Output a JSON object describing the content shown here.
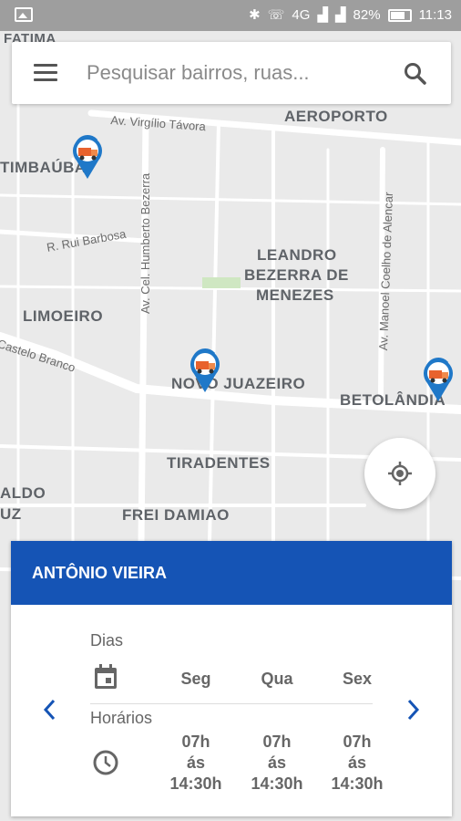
{
  "status_bar": {
    "gallery_icon": "image-icon",
    "icons": [
      "bluetooth-icon",
      "call-icon",
      "signal-4g-icon",
      "signal-icon"
    ],
    "network_label": "4G",
    "battery_percent": "82%",
    "time": "11:13"
  },
  "search": {
    "placeholder": "Pesquisar bairros, ruas...",
    "value": "",
    "menu_icon": "menu-icon",
    "search_icon": "search-icon"
  },
  "map": {
    "neighborhoods": [
      "FATIMA",
      "AEROPORTO",
      "TIMBAÚBA",
      "LEANDRO",
      "BEZERRA DE",
      "MENEZES",
      "LIMOEIRO",
      "NOVO JUAZEIRO",
      "BETOLÂNDIA",
      "TIRADENTES",
      "ALDO",
      "UZ",
      "FREI DAMIAO"
    ],
    "streets": [
      "Av. Virgílio Távora",
      "Av. Cel. Humberto Bezerra",
      "R. Rui Barbosa",
      "Av. Manoel Coelho de Alencar",
      "Castelo Branco"
    ],
    "pin_icon": "garbage-truck-pin-icon"
  },
  "locate_button": {
    "icon": "my-location-icon"
  },
  "schedule_card": {
    "title": "ANTÔNIO VIEIRA",
    "days_label": "Dias",
    "hours_label": "Horários",
    "days": [
      "Seg",
      "Qua",
      "Sex"
    ],
    "hours": [
      {
        "start": "07h",
        "sep": "ás",
        "end": "14:30h"
      },
      {
        "start": "07h",
        "sep": "ás",
        "end": "14:30h"
      },
      {
        "start": "07h",
        "sep": "ás",
        "end": "14:30h"
      }
    ],
    "accent_color": "#1554b5",
    "calendar_icon": "calendar-icon",
    "clock_icon": "clock-icon",
    "prev_icon": "chevron-left-icon",
    "next_icon": "chevron-right-icon"
  }
}
